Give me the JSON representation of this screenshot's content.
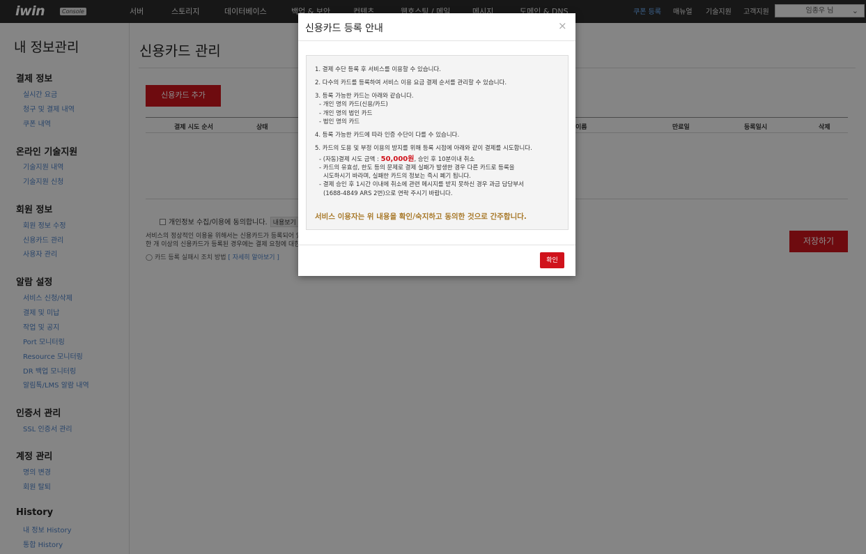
{
  "topbar": {
    "logo_text": "iwin",
    "logo_badge": "Console",
    "nav": [
      "서버",
      "스토리지",
      "데이터베이스",
      "백업 & 보안",
      "컨텐츠",
      "웹호스팅 / 메일",
      "메시지",
      "도메인 & DNS"
    ],
    "right_links": [
      "쿠폰 등록",
      "매뉴얼",
      "기술지원",
      "고객지원"
    ],
    "user_label": "임종우 님",
    "accent_color": "#6fb3ff"
  },
  "sidebar": {
    "title": "내 정보관리",
    "sections": [
      {
        "heading": "결제 정보",
        "items": [
          "실시간 요금",
          "청구 및 결제 내역",
          "쿠폰 내역"
        ]
      },
      {
        "heading": "온라인 기술지원",
        "items": [
          "기술지원 내역",
          "기술지원 신청"
        ]
      },
      {
        "heading": "회원 정보",
        "items": [
          "회원 정보 수정",
          "신용카드 관리",
          "사용자 관리"
        ]
      },
      {
        "heading": "알람 설정",
        "items": [
          "서비스 신청/삭제",
          "결제 및 미납",
          "작업 및 공지",
          "Port 모니터링",
          "Resource 모니터링",
          "DR 백업 모니터링",
          "알림톡/LMS 알람 내역"
        ]
      },
      {
        "heading": "인증서 관리",
        "items": [
          "SSL 인증서 관리"
        ]
      },
      {
        "heading": "계정 관리",
        "items": [
          "명의 변경",
          "회원 탈퇴"
        ]
      },
      {
        "heading": "History",
        "items": [
          "내 정보 History",
          "통합 History"
        ]
      }
    ]
  },
  "main": {
    "title": "신용카드 관리",
    "add_button": "신용카드 추가",
    "columns": [
      "결제 시도 순서",
      "상태",
      "이름",
      "만료일",
      "등록일시",
      "삭제"
    ],
    "agree_label": "개인정보 수집/이용에 동의합니다.",
    "view_button": "내용보기",
    "note_lines": [
      "서비스의 정상적인 이용을 위해서는 신용카드가 등록되어 있어",
      "한 개 이상의 신용카드가 등록된 경우에는 결제 요청에 대한 승"
    ],
    "tip_text": "카드 등록 실패시 조치 방법",
    "tip_more": "[ 자세히 알아보기 ]",
    "save_button": "저장하기",
    "brand_color": "#c9141c"
  },
  "modal": {
    "title": "신용카드 등록 안내",
    "close_symbol": "×",
    "lines": {
      "l1": "1. 결제 수단 등록 후 서비스를 이용할 수 있습니다.",
      "l2": "2. 다수의 카드를 등록하여 서비스 이용 요금 결제 순서를 관리할 수 있습니다.",
      "l3": "3. 등록 가능한 카드는 아래와 같습니다.",
      "l3a": "- 개인 명의 카드(신용/카드)",
      "l3b": "- 개인 명의 법인 카드",
      "l3c": "- 법인 명의 카드",
      "l4": "4. 등록 가능한 카드에 따라 인증 수단이 다를 수 있습니다.",
      "l5": "5. 카드의 도용 및 부정 이용의 방지를 위해 등록 시점에 아래와 같이 결제를 시도합니다.",
      "l5a_pre": "- (자동)결제 시도 금액 : ",
      "l5a_amount": "50,000원",
      "l5a_post": ", 승인 후 10분이내 취소",
      "l5b": "- 카드의 유효성, 한도 등의 문제로 결제 실패가 발생한 경우 다른 카드로 등록을",
      "l5b2": "시도하시기 바라며, 실패한 카드의 정보는 즉시 폐기 됩니다.",
      "l5c": "- 결제 승인 후 1시간 이내에 취소에 관련 메시지를 받지 못하신 경우 과금 담당부서",
      "l5c2": "(1688-4849 ARS 2번)으로 연락 주시기 바랍니다."
    },
    "confirm_message": "서비스 이용자는 위 내용을 확인/숙지하고 동의한 것으로 간주합니다.",
    "ok_button": "확인"
  }
}
